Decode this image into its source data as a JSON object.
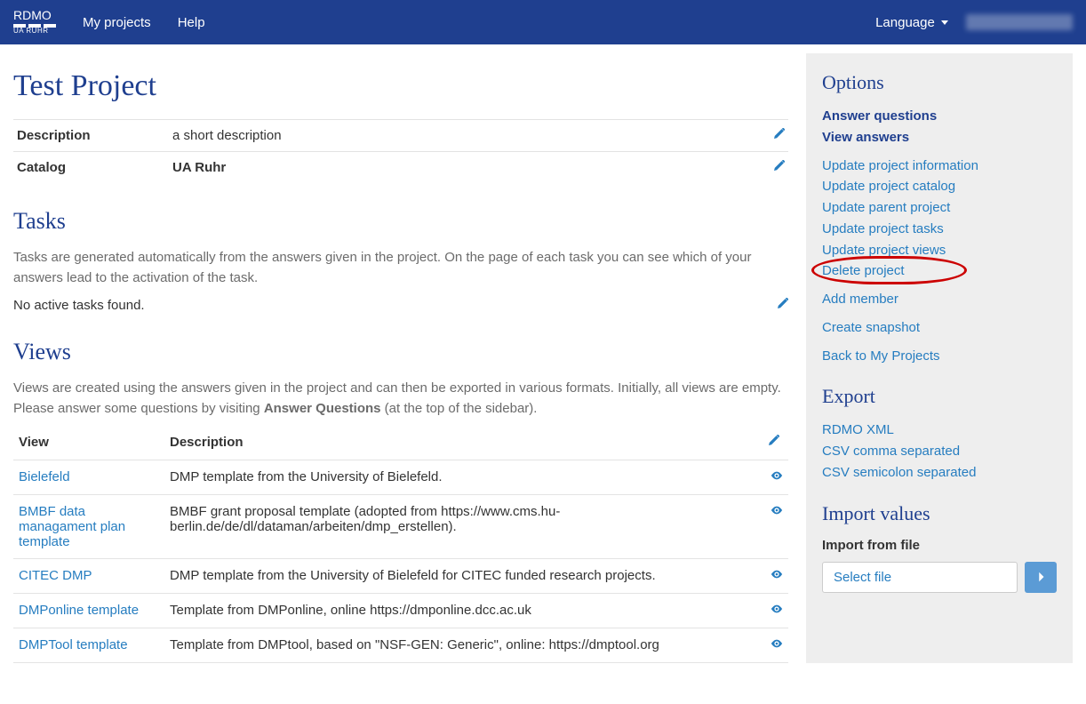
{
  "nav": {
    "brand": "RDMO",
    "brand_sub": "UA RUHR",
    "my_projects": "My projects",
    "help": "Help",
    "language": "Language"
  },
  "project": {
    "title": "Test Project",
    "description_label": "Description",
    "description_value": "a short description",
    "catalog_label": "Catalog",
    "catalog_value": "UA Ruhr"
  },
  "tasks": {
    "heading": "Tasks",
    "intro": "Tasks are generated automatically from the answers given in the project. On the page of each task you can see which of your answers lead to the activation of the task.",
    "empty": "No active tasks found."
  },
  "views_section": {
    "heading": "Views",
    "intro_a": "Views are created using the answers given in the project and can then be exported in various formats. Initially, all views are empty. Please answer some questions by visiting ",
    "intro_strong": "Answer Questions",
    "intro_b": " (at the top of the sidebar).",
    "col_view": "View",
    "col_desc": "Description",
    "rows": [
      {
        "name": "Bielefeld",
        "desc": "DMP template from the University of Bielefeld."
      },
      {
        "name": "BMBF data managament plan template",
        "desc": "BMBF grant proposal template (adopted from https://www.cms.hu-berlin.de/de/dl/dataman/arbeiten/dmp_erstellen)."
      },
      {
        "name": "CITEC DMP",
        "desc": "DMP template from the University of Bielefeld for CITEC funded research projects."
      },
      {
        "name": "DMPonline template",
        "desc": "Template from DMPonline, online https://dmponline.dcc.ac.uk"
      },
      {
        "name": "DMPTool template",
        "desc": "Template from DMPtool, based on \"NSF-GEN: Generic\", online: https://dmptool.org"
      }
    ]
  },
  "sidebar": {
    "options_heading": "Options",
    "answer_questions": "Answer questions",
    "view_answers": "View answers",
    "update_info": "Update project information",
    "update_catalog": "Update project catalog",
    "update_parent": "Update parent project",
    "update_tasks": "Update project tasks",
    "update_views": "Update project views",
    "delete_project": "Delete project",
    "add_member": "Add member",
    "create_snapshot": "Create snapshot",
    "back": "Back to My Projects",
    "export_heading": "Export",
    "export_xml": "RDMO XML",
    "export_csv_comma": "CSV comma separated",
    "export_csv_semi": "CSV semicolon separated",
    "import_heading": "Import values",
    "import_label": "Import from file",
    "select_file": "Select file"
  }
}
